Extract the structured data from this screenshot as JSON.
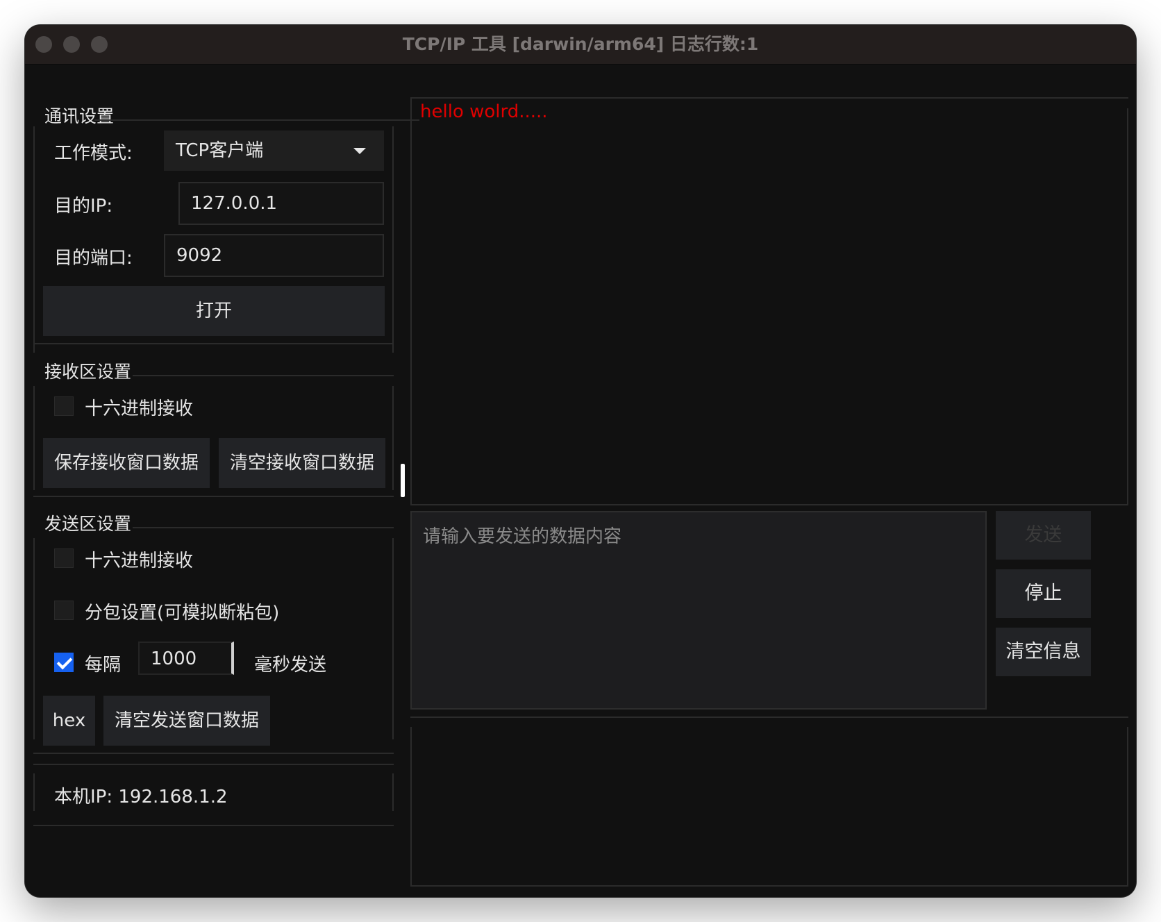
{
  "window": {
    "title": "TCP/IP 工具 [darwin/arm64] 日志行数:1"
  },
  "comm_settings": {
    "group_label": "通讯设置",
    "mode_label": "工作模式:",
    "mode_value": "TCP客户端",
    "ip_label": "目的IP:",
    "ip_value": "127.0.0.1",
    "port_label": "目的端口:",
    "port_value": "9092",
    "open_button": "打开"
  },
  "recv_settings": {
    "group_label": "接收区设置",
    "hex_recv_label": "十六进制接收",
    "hex_recv_checked": false,
    "save_button": "保存接收窗口数据",
    "clear_button": "清空接收窗口数据"
  },
  "send_settings": {
    "group_label": "发送区设置",
    "hex_label": "十六进制接收",
    "hex_checked": false,
    "packet_label": "分包设置(可模拟断粘包)",
    "packet_checked": false,
    "interval_prefix": "每隔",
    "interval_checked": true,
    "interval_value": "1000",
    "interval_suffix": "毫秒发送",
    "hex_button": "hex",
    "clear_button": "清空发送窗口数据"
  },
  "local": {
    "ip_label": "本机IP:",
    "ip_value": "192.168.1.2"
  },
  "receive_area": {
    "text": "hello wolrd.....",
    "text_color": "#e00000"
  },
  "send_area": {
    "placeholder": "请输入要发送的数据内容",
    "send_button": "发送",
    "stop_button": "停止",
    "clear_info_button": "清空信息"
  },
  "colors": {
    "background": "#111111",
    "checkbox_accent": "#1661f0"
  }
}
